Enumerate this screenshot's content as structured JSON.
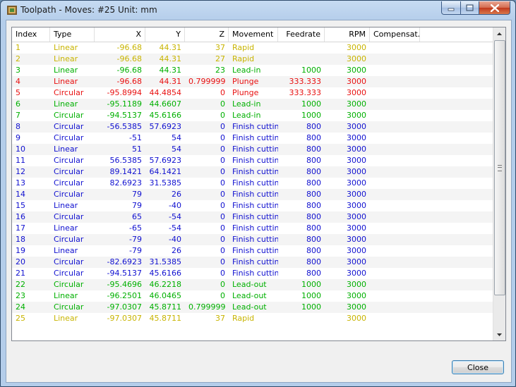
{
  "window": {
    "title": "Toolpath - Moves: #25 Unit: mm"
  },
  "colors": {
    "rapid": "#c8b400",
    "leadin": "#00b000",
    "plunge": "#e81010",
    "finish": "#1010d0"
  },
  "table": {
    "columns": [
      "Index",
      "Type",
      "X",
      "Y",
      "Z",
      "Movement",
      "Feedrate",
      "RPM",
      "Compensat...",
      ""
    ],
    "rows": [
      {
        "idx": "1",
        "type": "Linear",
        "x": "-96.68",
        "y": "44.31",
        "z": "37",
        "mov": "Rapid",
        "feed": "",
        "rpm": "3000",
        "comp": "",
        "color": "#c8b400"
      },
      {
        "idx": "2",
        "type": "Linear",
        "x": "-96.68",
        "y": "44.31",
        "z": "27",
        "mov": "Rapid",
        "feed": "",
        "rpm": "3000",
        "comp": "",
        "color": "#c8b400"
      },
      {
        "idx": "3",
        "type": "Linear",
        "x": "-96.68",
        "y": "44.31",
        "z": "23",
        "mov": "Lead-in",
        "feed": "1000",
        "rpm": "3000",
        "comp": "",
        "color": "#00b000"
      },
      {
        "idx": "4",
        "type": "Linear",
        "x": "-96.68",
        "y": "44.31",
        "z": "0.799999",
        "mov": "Plunge",
        "feed": "333.333",
        "rpm": "3000",
        "comp": "",
        "color": "#e81010"
      },
      {
        "idx": "5",
        "type": "Circular",
        "x": "-95.8994",
        "y": "44.4854",
        "z": "0",
        "mov": "Plunge",
        "feed": "333.333",
        "rpm": "3000",
        "comp": "",
        "color": "#e81010"
      },
      {
        "idx": "6",
        "type": "Linear",
        "x": "-95.1189",
        "y": "44.6607",
        "z": "0",
        "mov": "Lead-in",
        "feed": "1000",
        "rpm": "3000",
        "comp": "",
        "color": "#00b000"
      },
      {
        "idx": "7",
        "type": "Circular",
        "x": "-94.5137",
        "y": "45.6166",
        "z": "0",
        "mov": "Lead-in",
        "feed": "1000",
        "rpm": "3000",
        "comp": "",
        "color": "#00b000"
      },
      {
        "idx": "8",
        "type": "Circular",
        "x": "-56.5385",
        "y": "57.6923",
        "z": "0",
        "mov": "Finish cutting",
        "feed": "800",
        "rpm": "3000",
        "comp": "",
        "color": "#1010d0"
      },
      {
        "idx": "9",
        "type": "Circular",
        "x": "-51",
        "y": "54",
        "z": "0",
        "mov": "Finish cutting",
        "feed": "800",
        "rpm": "3000",
        "comp": "",
        "color": "#1010d0"
      },
      {
        "idx": "10",
        "type": "Linear",
        "x": "51",
        "y": "54",
        "z": "0",
        "mov": "Finish cutting",
        "feed": "800",
        "rpm": "3000",
        "comp": "",
        "color": "#1010d0"
      },
      {
        "idx": "11",
        "type": "Circular",
        "x": "56.5385",
        "y": "57.6923",
        "z": "0",
        "mov": "Finish cutting",
        "feed": "800",
        "rpm": "3000",
        "comp": "",
        "color": "#1010d0"
      },
      {
        "idx": "12",
        "type": "Circular",
        "x": "89.1421",
        "y": "64.1421",
        "z": "0",
        "mov": "Finish cutting",
        "feed": "800",
        "rpm": "3000",
        "comp": "",
        "color": "#1010d0"
      },
      {
        "idx": "13",
        "type": "Circular",
        "x": "82.6923",
        "y": "31.5385",
        "z": "0",
        "mov": "Finish cutting",
        "feed": "800",
        "rpm": "3000",
        "comp": "",
        "color": "#1010d0"
      },
      {
        "idx": "14",
        "type": "Circular",
        "x": "79",
        "y": "26",
        "z": "0",
        "mov": "Finish cutting",
        "feed": "800",
        "rpm": "3000",
        "comp": "",
        "color": "#1010d0"
      },
      {
        "idx": "15",
        "type": "Linear",
        "x": "79",
        "y": "-40",
        "z": "0",
        "mov": "Finish cutting",
        "feed": "800",
        "rpm": "3000",
        "comp": "",
        "color": "#1010d0"
      },
      {
        "idx": "16",
        "type": "Circular",
        "x": "65",
        "y": "-54",
        "z": "0",
        "mov": "Finish cutting",
        "feed": "800",
        "rpm": "3000",
        "comp": "",
        "color": "#1010d0"
      },
      {
        "idx": "17",
        "type": "Linear",
        "x": "-65",
        "y": "-54",
        "z": "0",
        "mov": "Finish cutting",
        "feed": "800",
        "rpm": "3000",
        "comp": "",
        "color": "#1010d0"
      },
      {
        "idx": "18",
        "type": "Circular",
        "x": "-79",
        "y": "-40",
        "z": "0",
        "mov": "Finish cutting",
        "feed": "800",
        "rpm": "3000",
        "comp": "",
        "color": "#1010d0"
      },
      {
        "idx": "19",
        "type": "Linear",
        "x": "-79",
        "y": "26",
        "z": "0",
        "mov": "Finish cutting",
        "feed": "800",
        "rpm": "3000",
        "comp": "",
        "color": "#1010d0"
      },
      {
        "idx": "20",
        "type": "Circular",
        "x": "-82.6923",
        "y": "31.5385",
        "z": "0",
        "mov": "Finish cutting",
        "feed": "800",
        "rpm": "3000",
        "comp": "",
        "color": "#1010d0"
      },
      {
        "idx": "21",
        "type": "Circular",
        "x": "-94.5137",
        "y": "45.6166",
        "z": "0",
        "mov": "Finish cutting",
        "feed": "800",
        "rpm": "3000",
        "comp": "",
        "color": "#1010d0"
      },
      {
        "idx": "22",
        "type": "Circular",
        "x": "-95.4696",
        "y": "46.2218",
        "z": "0",
        "mov": "Lead-out",
        "feed": "1000",
        "rpm": "3000",
        "comp": "",
        "color": "#00b000"
      },
      {
        "idx": "23",
        "type": "Linear",
        "x": "-96.2501",
        "y": "46.0465",
        "z": "0",
        "mov": "Lead-out",
        "feed": "1000",
        "rpm": "3000",
        "comp": "",
        "color": "#00b000"
      },
      {
        "idx": "24",
        "type": "Circular",
        "x": "-97.0307",
        "y": "45.8711",
        "z": "0.799999",
        "mov": "Lead-out",
        "feed": "1000",
        "rpm": "3000",
        "comp": "",
        "color": "#00b000"
      },
      {
        "idx": "25",
        "type": "Linear",
        "x": "-97.0307",
        "y": "45.8711",
        "z": "37",
        "mov": "Rapid",
        "feed": "",
        "rpm": "3000",
        "comp": "",
        "color": "#c8b400"
      }
    ]
  },
  "footer": {
    "close_label": "Close"
  }
}
